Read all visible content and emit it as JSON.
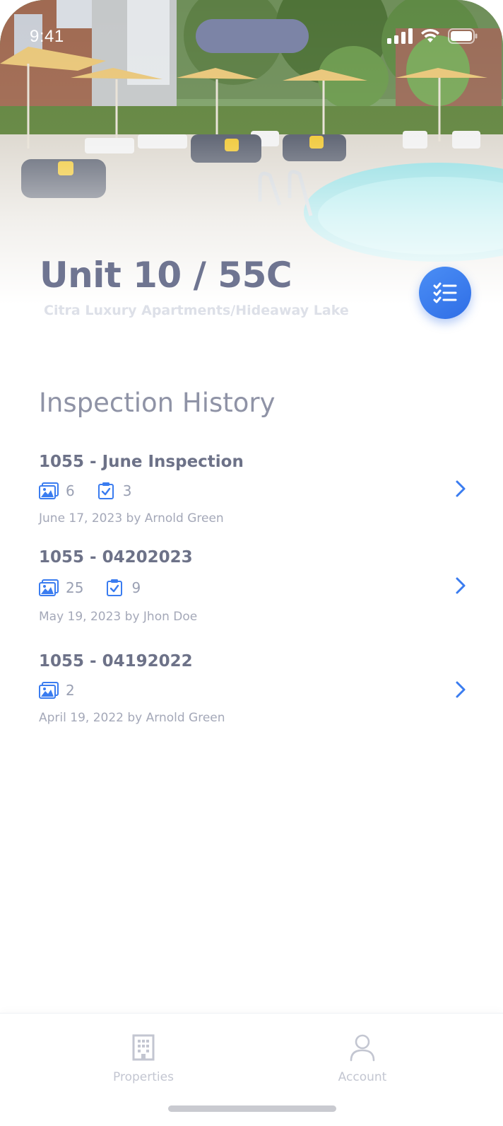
{
  "status_bar": {
    "time": "9:41",
    "icons": [
      "signal-icon",
      "wifi-icon",
      "battery-icon"
    ]
  },
  "header": {
    "title": "Unit 10 / 55C",
    "subtitle": "Citra Luxury Apartments/Hideaway Lake",
    "fab_icon": "checklist-icon",
    "hero_image": "pool-courtyard-photo"
  },
  "section": {
    "title": "Inspection History"
  },
  "inspections": [
    {
      "title": "1055 - June Inspection",
      "photos": "6",
      "tasks": "3",
      "date": "June 17, 2023 by Arnold Green"
    },
    {
      "title": "1055 - 04202023",
      "photos": "25",
      "tasks": "9",
      "date": "May 19, 2023 by Jhon Doe"
    },
    {
      "title": "1055 - 04192022",
      "photos": "2",
      "date": "April 19, 2022 by Arnold Green"
    }
  ],
  "tabbar": {
    "items": [
      {
        "label": "Properties",
        "icon": "building-icon"
      },
      {
        "label": "Account",
        "icon": "person-icon"
      }
    ]
  },
  "colors": {
    "accent": "#3a7cf0",
    "title": "#6f7591",
    "muted": "#a4a8b8"
  }
}
